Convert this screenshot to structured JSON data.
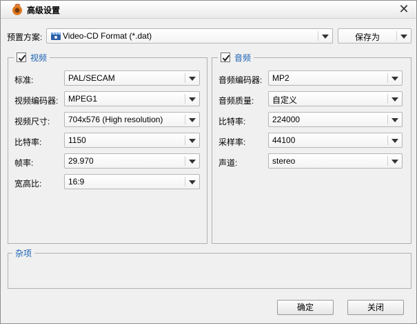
{
  "window": {
    "title": "高级设置"
  },
  "preset": {
    "label": "预置方案:",
    "value": "Video-CD Format (*.dat)",
    "save_as": "保存为"
  },
  "video": {
    "title": "视频",
    "checked": true,
    "fields": [
      {
        "label": "标准:",
        "value": "PAL/SECAM"
      },
      {
        "label": "视频编码器:",
        "value": "MPEG1"
      },
      {
        "label": "视频尺寸:",
        "value": "704x576 (High resolution)"
      },
      {
        "label": "比特率:",
        "value": "1150"
      },
      {
        "label": "帧率:",
        "value": "29.970"
      },
      {
        "label": "宽高比:",
        "value": "16:9"
      }
    ]
  },
  "audio": {
    "title": "音频",
    "checked": true,
    "fields": [
      {
        "label": "音频编码器:",
        "value": "MP2"
      },
      {
        "label": "音频质量:",
        "value": "自定义"
      },
      {
        "label": "比特率:",
        "value": "224000"
      },
      {
        "label": "采样率:",
        "value": "44100"
      },
      {
        "label": "声道:",
        "value": "stereo"
      }
    ]
  },
  "misc": {
    "title": "杂项"
  },
  "buttons": {
    "ok": "确定",
    "close": "关闭"
  },
  "colors": {
    "group_title": "#1a62b4",
    "window_bg": "#f0f0f0"
  }
}
